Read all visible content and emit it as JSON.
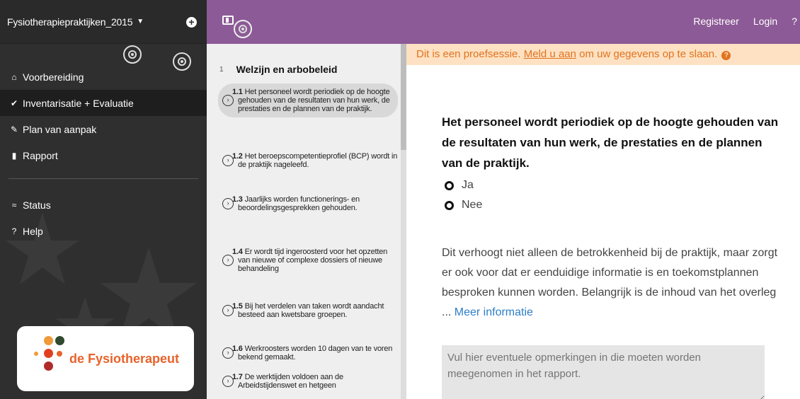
{
  "sidebar": {
    "project_title": "Fysiotherapiepraktijken_2015",
    "dropdown_caret": "▼",
    "add_label": "+",
    "items": [
      {
        "icon": "home-icon",
        "glyph": "🏠",
        "label": "Voorbereiding"
      },
      {
        "icon": "check-circle-icon",
        "glyph": "✔",
        "label": "Inventarisatie + Evaluatie"
      },
      {
        "icon": "pencil-icon",
        "glyph": "✎",
        "label": "Plan van aanpak"
      },
      {
        "icon": "file-icon",
        "glyph": "▮",
        "label": "Rapport"
      },
      {
        "icon": "chart-line-icon",
        "glyph": "≈",
        "label": "Status"
      },
      {
        "icon": "question-circle-icon",
        "glyph": "?",
        "label": "Help"
      }
    ],
    "logo_text": "de Fysiotherapeut"
  },
  "topbar": {
    "register": "Registreer",
    "login": "Login",
    "help": "?"
  },
  "question_list": {
    "section_number": "1",
    "section_title": "Welzijn en arbobeleid",
    "items": [
      {
        "num": "1.1",
        "text": "Het personeel wordt periodiek op de hoogte gehouden van de resultaten van hun werk, de prestaties en de plannen van de praktijk."
      },
      {
        "num": "1.2",
        "text": "Het beroepscompetentieprofiel (BCP) wordt in de praktijk nageleefd."
      },
      {
        "num": "1.3",
        "text": "Jaarlijks worden functionerings- en beoordelingsgesprekken gehouden."
      },
      {
        "num": "1.4",
        "text": "Er wordt tijd ingeroosterd voor het opzetten van nieuwe of complexe dossiers of nieuwe behandeling"
      },
      {
        "num": "1.5",
        "text": "Bij het verdelen van taken wordt aandacht besteed aan kwetsbare groepen."
      },
      {
        "num": "1.6",
        "text": "Werkroosters worden 10 dagen van te voren bekend gemaakt."
      },
      {
        "num": "1.7",
        "text": "De werktijden voldoen aan de Arbeidstijdenswet en hetgeen"
      }
    ]
  },
  "main": {
    "notice_prefix": "Dit is een proefsessie. ",
    "notice_link": "Meld u aan",
    "notice_suffix": " om uw gegevens op te slaan.",
    "question": "Het personeel wordt periodiek op de hoogte gehouden van de resultaten van hun werk, de prestaties en de plannen van de praktijk.",
    "options": [
      "Ja",
      "Nee"
    ],
    "info_text": "Dit verhoogt niet alleen de betrokkenheid bij de praktijk, maar zorgt er ook voor dat er eenduidige informatie is en toekomstplannen besproken kunnen worden. Belangrijk is de inhoud van het overleg ... ",
    "info_link": "Meer informatie",
    "remarks_placeholder": "Vul hier eventuele opmerkingen in die moeten worden meegenomen in het rapport."
  },
  "colors": {
    "sidebar_bg": "#2f2f2f",
    "topbar_bg": "#8c5a96",
    "notice_bg": "#fde1c2",
    "notice_text": "#e2731f",
    "link": "#2d7ec7"
  }
}
